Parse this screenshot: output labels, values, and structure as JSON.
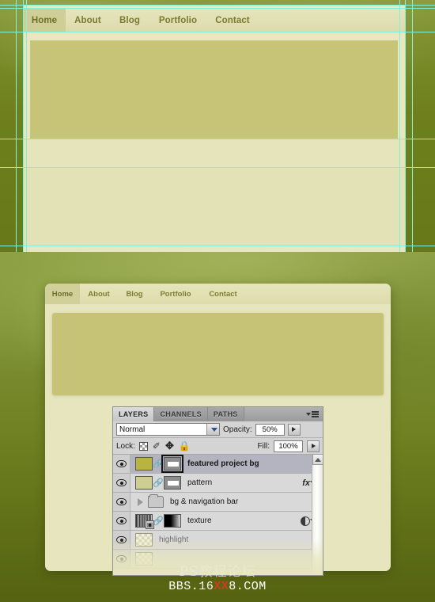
{
  "top_view": {
    "name": "design-zoom-view",
    "nav": {
      "items": [
        {
          "label": "Home",
          "active": true
        },
        {
          "label": "About",
          "active": false
        },
        {
          "label": "Blog",
          "active": false
        },
        {
          "label": "Portfolio",
          "active": false
        },
        {
          "label": "Contact",
          "active": false
        }
      ]
    },
    "guides": {
      "color": "#7ff2d8",
      "vertical_x": [
        20,
        29,
        33,
        505,
        512,
        521
      ],
      "horizontal_y": [
        6,
        10,
        40,
        175,
        211,
        310
      ]
    },
    "colors": {
      "page_bg": "#e8e7c0",
      "nav_bg": "#e0dfb2",
      "nav_active_bg": "#cfce97",
      "feature_bg": "#c7c478",
      "canvas_olive": "#6e7f1c"
    }
  },
  "bottom_view": {
    "name": "website-mockup-preview",
    "nav": {
      "items": [
        {
          "label": "Home",
          "active": true
        },
        {
          "label": "About",
          "active": false
        },
        {
          "label": "Blog",
          "active": false
        },
        {
          "label": "Portfolio",
          "active": false
        },
        {
          "label": "Contact",
          "active": false
        }
      ]
    },
    "colors": {
      "card_bg": "#e6e5bd",
      "feature_bg": "#c6c377",
      "backdrop": "#6f8122"
    }
  },
  "layers_panel": {
    "tabs": [
      {
        "label": "LAYERS",
        "active": true
      },
      {
        "label": "CHANNELS",
        "active": false
      },
      {
        "label": "PATHS",
        "active": false
      }
    ],
    "menu_icon": "panel-menu-icon",
    "blend_mode": {
      "value": "Normal",
      "dropdown_icon": "chevron-down-icon"
    },
    "opacity": {
      "label": "Opacity:",
      "value": "50%",
      "stepper_icon": "stepper-arrow-icon"
    },
    "lock": {
      "label": "Lock:",
      "icons": [
        {
          "name": "lock-transparency-icon",
          "glyph": ""
        },
        {
          "name": "lock-image-pixels-brush-icon",
          "glyph": "✎"
        },
        {
          "name": "lock-position-move-icon",
          "glyph": "✥"
        },
        {
          "name": "lock-all-padlock-icon",
          "glyph": "🔒"
        }
      ]
    },
    "fill": {
      "label": "Fill:",
      "value": "100%",
      "stepper_icon": "stepper-arrow-icon"
    },
    "layers": [
      {
        "name": "featured project bg",
        "visible": true,
        "selected": true,
        "thumb_kind": "color-olive",
        "has_link": true,
        "has_mask": true,
        "mask_active": true,
        "has_fx": false,
        "has_adjustment": false,
        "is_group": false,
        "dimmed": false
      },
      {
        "name": "pattern",
        "visible": true,
        "selected": false,
        "thumb_kind": "color-paleolive",
        "has_link": true,
        "has_mask": true,
        "mask_active": false,
        "has_fx": true,
        "has_adjustment": false,
        "is_group": false,
        "dimmed": false
      },
      {
        "name": "bg & navigation bar",
        "visible": true,
        "selected": false,
        "thumb_kind": "folder",
        "has_link": false,
        "has_mask": false,
        "mask_active": false,
        "has_fx": false,
        "has_adjustment": false,
        "is_group": true,
        "dimmed": false
      },
      {
        "name": "texture",
        "visible": true,
        "selected": false,
        "thumb_kind": "noise",
        "has_link": true,
        "has_mask": true,
        "mask_active": false,
        "has_fx": false,
        "has_adjustment": true,
        "is_group": false,
        "dimmed": false
      },
      {
        "name": "highlight",
        "visible": true,
        "selected": false,
        "thumb_kind": "checker",
        "has_link": false,
        "has_mask": false,
        "mask_active": false,
        "has_fx": false,
        "has_adjustment": false,
        "is_group": false,
        "dimmed": true
      }
    ],
    "scrollbar": {
      "up_arrow_icon": "scroll-up-arrow-icon"
    }
  },
  "watermark": {
    "chinese": "PS教程论坛",
    "url_prefix": "BBS.16",
    "url_accent": "XX",
    "url_suffix": "8.COM",
    "accent_color": "#d33a20"
  }
}
